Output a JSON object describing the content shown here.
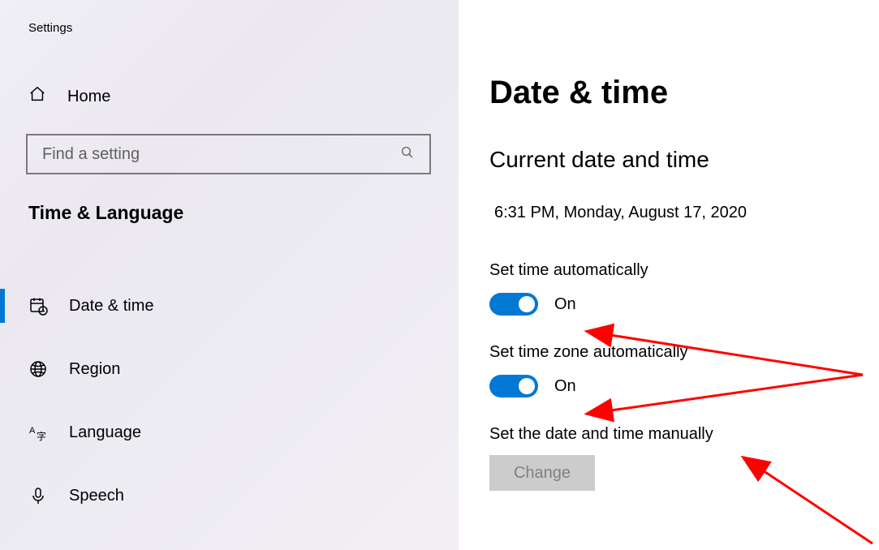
{
  "app_title": "Settings",
  "sidebar": {
    "home_label": "Home",
    "search_placeholder": "Find a setting",
    "section_label": "Time & Language",
    "items": [
      {
        "label": "Date & time",
        "icon": "calendar-clock-icon",
        "selected": true
      },
      {
        "label": "Region",
        "icon": "globe-icon",
        "selected": false
      },
      {
        "label": "Language",
        "icon": "language-icon",
        "selected": false
      },
      {
        "label": "Speech",
        "icon": "microphone-icon",
        "selected": false
      }
    ]
  },
  "main": {
    "page_title": "Date & time",
    "current_title": "Current date and time",
    "current_value": "6:31 PM, Monday, August 17, 2020",
    "set_time_auto_label": "Set time automatically",
    "set_time_auto_state": "On",
    "set_timezone_auto_label": "Set time zone automatically",
    "set_timezone_auto_state": "On",
    "set_manual_label": "Set the date and time manually",
    "change_button": "Change"
  },
  "colors": {
    "accent": "#0078d4",
    "annotation": "#ff0000"
  }
}
